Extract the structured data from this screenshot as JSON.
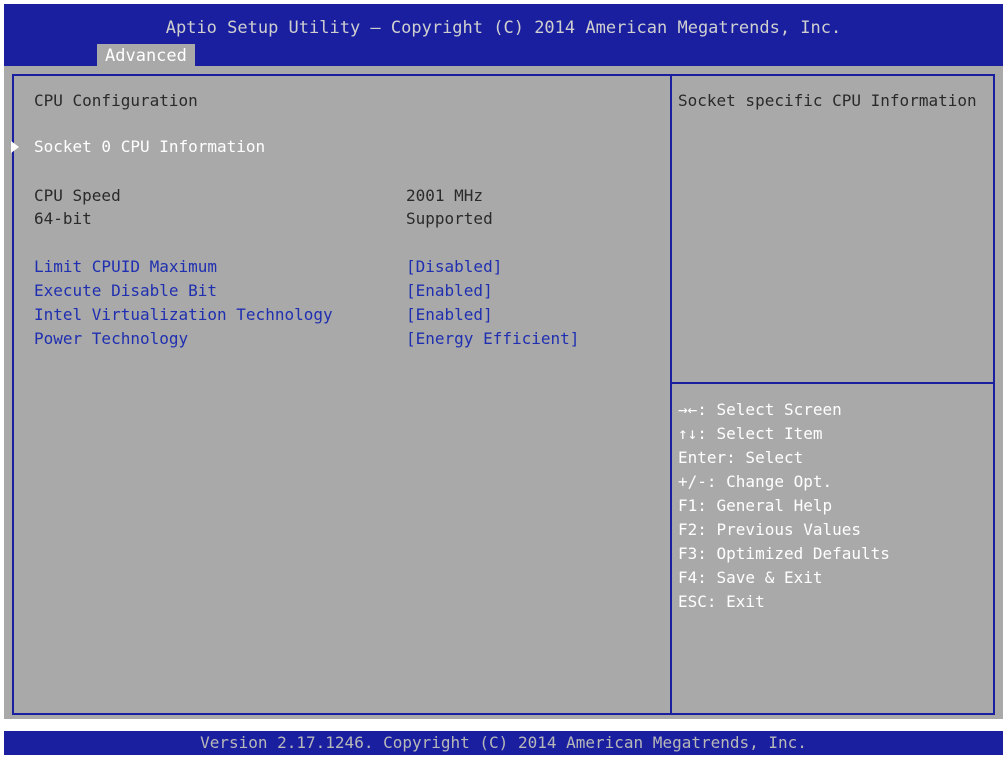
{
  "header": {
    "title": "Aptio Setup Utility – Copyright (C) 2014 American Megatrends, Inc.",
    "tab_label": "Advanced"
  },
  "main": {
    "page_title": "CPU Configuration",
    "submenu_label": "Socket 0 CPU Information",
    "info_rows": [
      {
        "label": "CPU Speed",
        "value": "2001 MHz"
      },
      {
        "label": "64-bit",
        "value": "Supported"
      }
    ],
    "settings": [
      {
        "label": "Limit CPUID Maximum",
        "value": "[Disabled]"
      },
      {
        "label": "Execute Disable Bit",
        "value": "[Enabled]"
      },
      {
        "label": "Intel Virtualization Technology",
        "value": "[Enabled]"
      },
      {
        "label": "Power Technology",
        "value": "[Energy Efficient]"
      }
    ]
  },
  "help": {
    "description": "Socket specific CPU Information",
    "keys": [
      "→←: Select Screen",
      "↑↓: Select Item",
      "Enter: Select",
      "+/-: Change Opt.",
      "F1: General Help",
      "F2: Previous Values",
      "F3: Optimized Defaults",
      "F4: Save & Exit",
      "ESC: Exit"
    ]
  },
  "footer": {
    "version": "Version 2.17.1246. Copyright (C) 2014 American Megatrends, Inc."
  },
  "colors": {
    "bar_blue": "#1a1fa0",
    "panel_gray": "#a9a9a9",
    "setting_blue": "#1f2fb0"
  }
}
